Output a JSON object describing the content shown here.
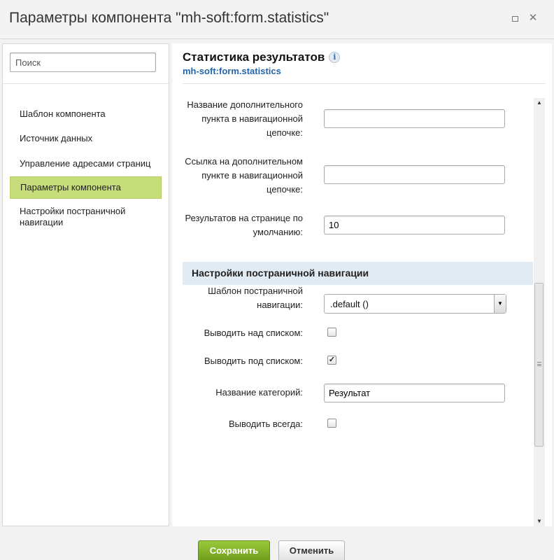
{
  "window": {
    "title": "Параметры компонента \"mh-soft:form.statistics\"",
    "maximize_icon": "maximize-icon",
    "close_icon": "close-icon",
    "close_glyph": "✕"
  },
  "sidebar": {
    "search_placeholder": "Поиск",
    "items": [
      {
        "label": "Шаблон компонента",
        "active": false
      },
      {
        "label": "Источник данных",
        "active": false
      },
      {
        "label": "Управление адресами страниц",
        "active": false
      },
      {
        "label": "Параметры компонента",
        "active": true
      },
      {
        "label": "Настройки постраничной навигации",
        "active": false
      }
    ],
    "active_color": "#c7dd7c"
  },
  "main": {
    "title": "Статистика результатов",
    "info_glyph": "i",
    "subtitle": "mh-soft:form.statistics",
    "fields": {
      "chain_item_name": {
        "label": "Название дополнительного пункта в навигационной цепочке:",
        "value": ""
      },
      "chain_item_link": {
        "label": "Ссылка на дополнительном пункте в навигационной цепочке:",
        "value": ""
      },
      "results_per_page": {
        "label": "Результатов на странице по умолчанию:",
        "value": "10"
      }
    },
    "section": {
      "title": "Настройки постраничной навигации",
      "color": "#e0ebf4"
    },
    "pager": {
      "template": {
        "label": "Шаблон постраничной навигации:",
        "value": ".default ()"
      },
      "show_top": {
        "label": "Выводить над списком:",
        "checked": false
      },
      "show_bottom": {
        "label": "Выводить под списком:",
        "checked": true
      },
      "category_title": {
        "label": "Название категорий:",
        "value": "Результат"
      },
      "show_always": {
        "label": "Выводить всегда:",
        "checked": false
      }
    }
  },
  "footer": {
    "save_label": "Сохранить",
    "cancel_label": "Отменить",
    "save_color": "#7fae27"
  }
}
